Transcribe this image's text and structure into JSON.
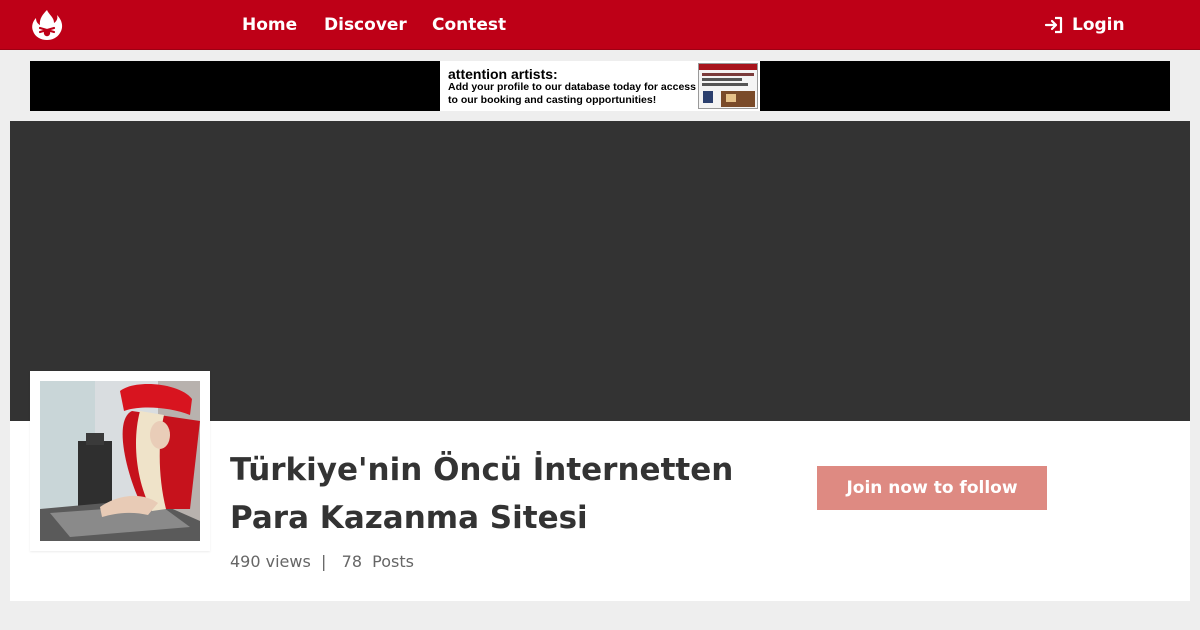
{
  "nav": {
    "logo_icon": "flame-logo-icon",
    "links": [
      "Home",
      "Discover",
      "Contest"
    ],
    "login_label": "Login",
    "login_icon": "sign-in-icon"
  },
  "ad": {
    "headline": "attention artists:",
    "body_line1": "Add your profile to our database today for access",
    "body_line2": "to our booking and casting opportunities!"
  },
  "profile": {
    "title_line1": "Türkiye'nin Öncü İnternetten",
    "title_line2": "Para Kazanma Sitesi",
    "views": "490 views",
    "separator": "|",
    "posts_count": "78",
    "posts_label": "Posts",
    "follow_label": "Join now to follow"
  },
  "colors": {
    "brand": "#be0017",
    "follow_button": "#de8a82",
    "cover": "#333333",
    "text": "#333333",
    "muted": "#666666"
  }
}
